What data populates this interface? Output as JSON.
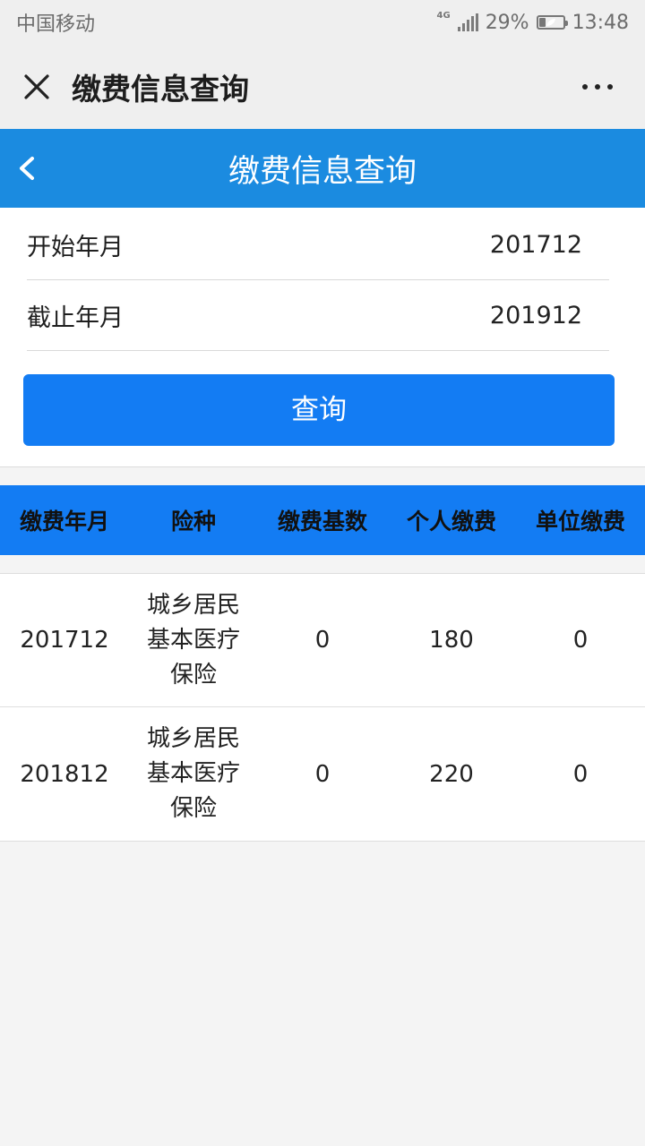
{
  "status_bar": {
    "carrier": "中国移动",
    "network_type": "4G",
    "battery": "29%",
    "battery_level": 0.29,
    "time": "13:48"
  },
  "titlebar": {
    "title": "缴费信息查询",
    "close_icon": "close-icon",
    "more_icon": "more-icon"
  },
  "header": {
    "title": "缴费信息查询",
    "back_icon": "back-chevron-icon",
    "color": "#1b8be0"
  },
  "form": {
    "start_label": "开始年月",
    "start_value": "201712",
    "end_label": "截止年月",
    "end_value": "201912",
    "query_button": "查询",
    "button_color": "#137cf3"
  },
  "table": {
    "columns": [
      "缴费年月",
      "险种",
      "缴费基数",
      "个人缴费",
      "单位缴费"
    ],
    "rows": [
      {
        "month": "201712",
        "insurance_line1": "城乡居民",
        "insurance_line2": "基本医疗",
        "insurance_line3": "保险",
        "base": "0",
        "personal": "180",
        "unit": "0"
      },
      {
        "month": "201812",
        "insurance_line1": "城乡居民",
        "insurance_line2": "基本医疗",
        "insurance_line3": "保险",
        "base": "0",
        "personal": "220",
        "unit": "0"
      }
    ]
  }
}
